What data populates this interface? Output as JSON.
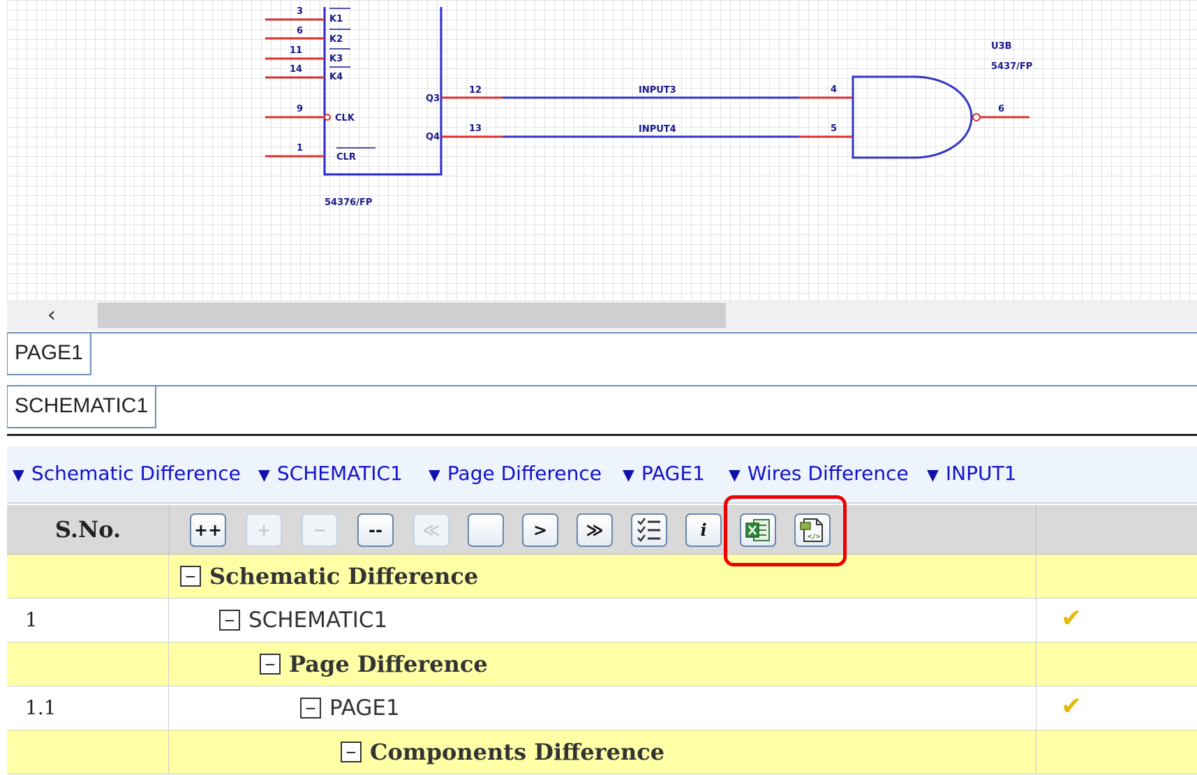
{
  "schematic": {
    "left_pins": [
      "3",
      "6",
      "11",
      "14",
      "9",
      "1"
    ],
    "pin_labels": [
      "K1",
      "K2",
      "K3",
      "K4",
      "CLK",
      "CLR"
    ],
    "output_pins": [
      "Q3",
      "Q4"
    ],
    "output_nums": [
      "12",
      "13"
    ],
    "nets": [
      "INPUT3",
      "INPUT4"
    ],
    "gate_inputs": [
      "4",
      "5"
    ],
    "gate_output": "6",
    "ic_part": "54376/FP",
    "gate_ref": "U3B",
    "gate_part": "5437/FP"
  },
  "scroll": {
    "left_arrow": "‹"
  },
  "tabs": {
    "page": "PAGE1",
    "schematic": "SCHEMATIC1"
  },
  "breadcrumb": [
    "Schematic Difference",
    "SCHEMATIC1",
    "Page Difference",
    "PAGE1",
    "Wires Difference",
    "INPUT1"
  ],
  "table": {
    "header_sno": "S.No.",
    "toolbar": {
      "expand_all": "++",
      "expand": "+",
      "collapse": "−",
      "collapse_all": "--",
      "first": "≪",
      "prev": "",
      "next": ">",
      "last": "≫",
      "info": "i"
    },
    "rows": [
      {
        "sno": "",
        "label": "Schematic Difference",
        "toggle": "−",
        "check": ""
      },
      {
        "sno": "1",
        "label": "SCHEMATIC1",
        "toggle": "−",
        "check": "✔"
      },
      {
        "sno": "",
        "label": "Page Difference",
        "toggle": "−",
        "check": ""
      },
      {
        "sno": "1.1",
        "label": "PAGE1",
        "toggle": "−",
        "check": "✔"
      },
      {
        "sno": "",
        "label": "Components Difference",
        "toggle": "−",
        "check": ""
      }
    ]
  },
  "colors": {
    "highlight": "#ee0000",
    "crumb": "#1111cc",
    "row_yellow": "#ffffa6",
    "check": "#e3b80a"
  }
}
